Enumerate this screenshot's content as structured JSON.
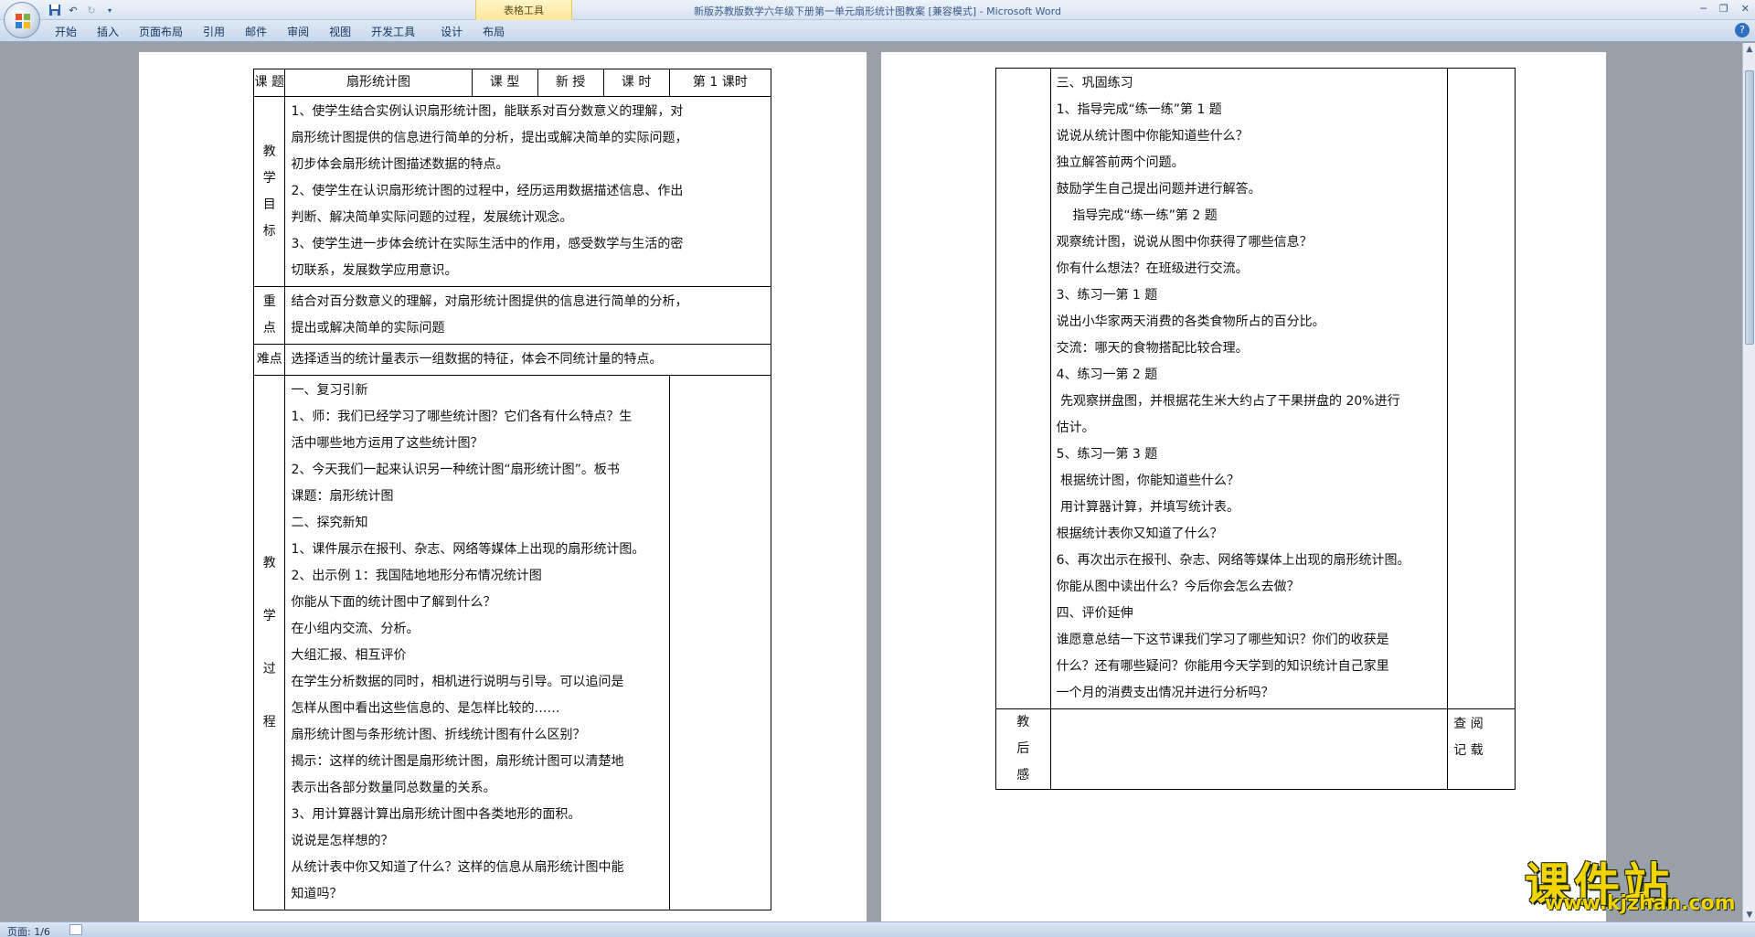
{
  "window": {
    "title": "新版苏教版数学六年级下册第一单元扇形统计图教案 [兼容模式] - Microsoft Word",
    "context_tab_group": "表格工具"
  },
  "ribbon": {
    "tabs": [
      "开始",
      "插入",
      "页面布局",
      "引用",
      "邮件",
      "审阅",
      "视图",
      "开发工具",
      "设计",
      "布局"
    ],
    "help": "?"
  },
  "status": {
    "page": "页面: 1/6"
  },
  "left_table": {
    "header": {
      "c1": "课 题",
      "c2": "扇形统计图",
      "c3": "课  型",
      "c4": "新  授",
      "c5": "课  时",
      "c6": "第 1 课时"
    },
    "goals": {
      "label_chars": [
        "教",
        "学",
        "目",
        "标"
      ],
      "lines": [
        "1、使学生结合实例认识扇形统计图，能联系对百分数意义的理解，对",
        "扇形统计图提供的信息进行简单的分析，提出或解决简单的实际问题，",
        "初步体会扇形统计图描述数据的特点。",
        "2、使学生在认识扇形统计图的过程中，经历运用数据描述信息、作出",
        "判断、解决简单实际问题的过程，发展统计观念。",
        "3、使学生进一步体会统计在实际生活中的作用，感受数学与生活的密",
        "切联系，发展数学应用意识。"
      ]
    },
    "key_points": {
      "label_chars": [
        "重",
        "点"
      ],
      "lines": [
        "结合对百分数意义的理解，对扇形统计图提供的信息进行简单的分析，",
        "提出或解决简单的实际问题"
      ]
    },
    "difficulty": {
      "label": "难点",
      "text": "选择适当的统计量表示一组数据的特征，体会不同统计量的特点。"
    },
    "process": {
      "label_chars": [
        "教",
        "学",
        "过",
        "程"
      ],
      "lines": [
        "一、复习引新",
        "1、师：我们已经学习了哪些统计图？它们各有什么特点？生",
        "活中哪些地方运用了这些统计图？",
        "2、今天我们一起来认识另一种统计图“扇形统计图”。板书",
        "课题：扇形统计图",
        "二、探究新知",
        "1、课件展示在报刊、杂志、网络等媒体上出现的扇形统计图。",
        "2、出示例 1：我国陆地地形分布情况统计图",
        "你能从下面的统计图中了解到什么？",
        "在小组内交流、分析。",
        "大组汇报、相互评价",
        "在学生分析数据的同时，相机进行说明与引导。可以追问是",
        "怎样从图中看出这些信息的、是怎样比较的……",
        "扇形统计图与条形统计图、折线统计图有什么区别？",
        "揭示：这样的统计图是扇形统计图，扇形统计图可以清楚地",
        "表示出各部分数量同总数量的关系。",
        "3、用计算器计算出扇形统计图中各类地形的面积。",
        "说说是怎样想的？",
        "从统计表中你又知道了什么？这样的信息从扇形统计图中能",
        "知道吗？"
      ]
    }
  },
  "right_table": {
    "lines": [
      "三、巩固练习",
      "1、指导完成“练一练”第 1 题",
      "说说从统计图中你能知道些什么？",
      "独立解答前两个问题。",
      "鼓励学生自己提出问题并进行解答。",
      "    指导完成“练一练”第 2 题",
      "观察统计图，说说从图中你获得了哪些信息？",
      "你有什么想法？在班级进行交流。",
      "3、练习一第 1 题",
      "说出小华家两天消费的各类食物所占的百分比。",
      "交流：哪天的食物搭配比较合理。",
      "4、练习一第 2 题",
      " 先观察拼盘图，并根据花生米大约占了干果拼盘的 20%进行",
      "估计。",
      "5、练习一第 3 题",
      " 根据统计图，你能知道些什么？",
      " 用计算器计算，并填写统计表。",
      "根据统计表你又知道了什么？",
      "6、再次出示在报刊、杂志、网络等媒体上出现的扇形统计图。",
      "你能从图中读出什么？今后你会怎么去做？",
      "四、评价延伸",
      "谁愿意总结一下这节课我们学习了哪些知识？你们的收获是",
      "什么？还有哪些疑问？你能用今天学到的知识统计自己家里",
      "一个月的消费支出情况并进行分析吗？"
    ],
    "reflection": {
      "label_chars": [
        "教",
        "后",
        "感"
      ],
      "review_lines": [
        "查 阅",
        "记 载"
      ]
    }
  },
  "watermark": {
    "cn": "课件站",
    "url": "www.kjzhan.com"
  }
}
